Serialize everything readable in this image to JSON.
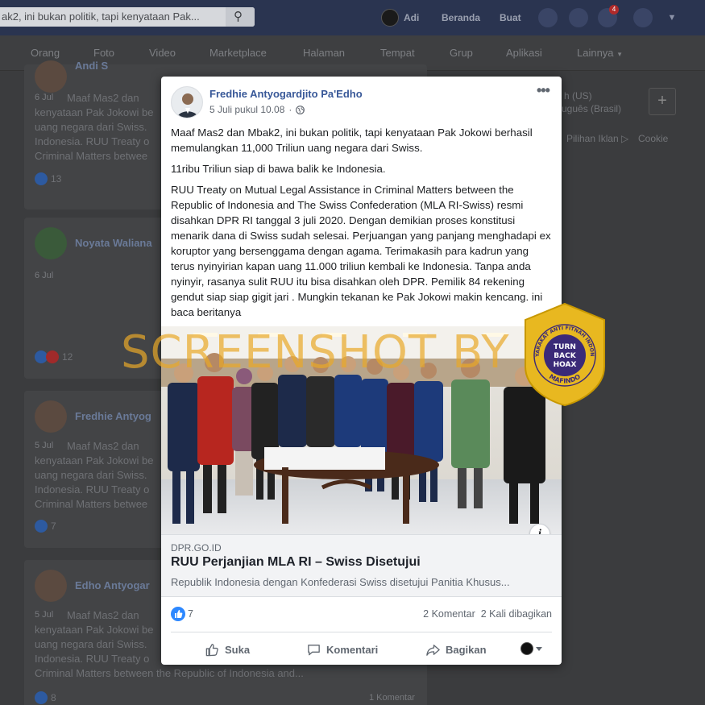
{
  "topbar": {
    "search_text": "ak2, ini bukan politik, tapi kenyataan Pak...",
    "user_name": "Adi",
    "home_label": "Beranda",
    "create_label": "Buat",
    "notification_count": "4"
  },
  "nav": {
    "items": [
      "Orang",
      "Foto",
      "Video",
      "Marketplace",
      "Halaman",
      "Tempat",
      "Grup",
      "Aplikasi",
      "Lainnya"
    ]
  },
  "background_posts": [
    {
      "name": "Andi S",
      "date": "6 Jul",
      "text": "Maaf Mas2 dan\nkenyataan Pak Jokowi be\nuang negara dari Swiss.\nIndonesia. RUU Treaty o\nCriminal Matters betwee",
      "likes": "13"
    },
    {
      "name": "Noyata Waliana",
      "date": "6 Jul",
      "text": "",
      "likes": "12"
    },
    {
      "name": "Fredhie Antyog",
      "date": "5 Jul",
      "text": "Maaf Mas2 dan\nkenyataan Pak Jokowi be\nuang negara dari Swiss.\nIndonesia. RUU Treaty o\nCriminal Matters betwee",
      "likes": "7"
    },
    {
      "name": "Edho Antyogar",
      "date": "5 Jul",
      "text": "Maaf Mas2 dan\nkenyataan Pak Jokowi be\nuang negara dari Swiss.\nIndonesia. RUU Treaty o\nCriminal Matters between the Republic of Indonesia and...",
      "likes": "8",
      "comments": "1 Komentar"
    }
  ],
  "right_column": {
    "lang_1": "h (US)",
    "lang_2": "uguês (Brasil)",
    "footer_1": "Pilihan Iklan",
    "footer_2": "Cookie"
  },
  "post": {
    "author": "Fredhie Antyogardjito Pa'Edho",
    "timestamp": "5 Juli pukul 10.08",
    "privacy_icon": "globe-icon",
    "paragraphs": [
      "Maaf Mas2 dan Mbak2, ini bukan politik, tapi kenyataan Pak Jokowi berhasil memulangkan 11,000 Triliun uang negara dari Swiss.",
      "11ribu Triliun siap di bawa balik ke Indonesia.",
      "RUU Treaty on Mutual Legal Assistance in Criminal Matters between the Republic of Indonesia and The Swiss Confederation (MLA RI-Swiss) resmi disahkan DPR RI tanggal 3 juli 2020. Dengan demikian proses konstitusi menarik dana di Swiss sudah selesai. Perjuangan yang panjang menghadapi ex koruptor yang bersenggama dengan agama. Terimakasih para kadrun yang terus nyinyirian kapan uang 11.000 triliun kembali ke Indonesia. Tanpa anda nyinyir, rasanya sulit RUU itu bisa disahkan oleh DPR. Pemilik 84 rekening gendut siap siap gigit jari . Mungkin tekanan ke Pak Jokowi makin kencang. ini baca beritanya"
    ],
    "link": {
      "domain": "DPR.GO.ID",
      "title": "RUU Perjanjian MLA RI – Swiss Disetujui",
      "description": "Republik Indonesia dengan Konfederasi Swiss disetujui Panitia Khusus..."
    },
    "likes": "7",
    "comments": "2 Komentar",
    "shares": "2 Kali dibagikan",
    "actions": {
      "like": "Suka",
      "comment": "Komentari",
      "share": "Bagikan"
    }
  },
  "overlay": {
    "watermark": "SCREENSHOT BY",
    "seal_top": "MASYARAKAT ANTI FITNAH INDONESIA",
    "seal_center": [
      "TURN",
      "BACK",
      "HOAX"
    ],
    "seal_bottom": "MAFINDO"
  },
  "colors": {
    "facebook_blue": "#385898",
    "like_blue": "#2d88ff",
    "seal_gold": "#e8b820",
    "seal_purple": "#3b2a78",
    "watermark_orange": "#e8a828"
  }
}
